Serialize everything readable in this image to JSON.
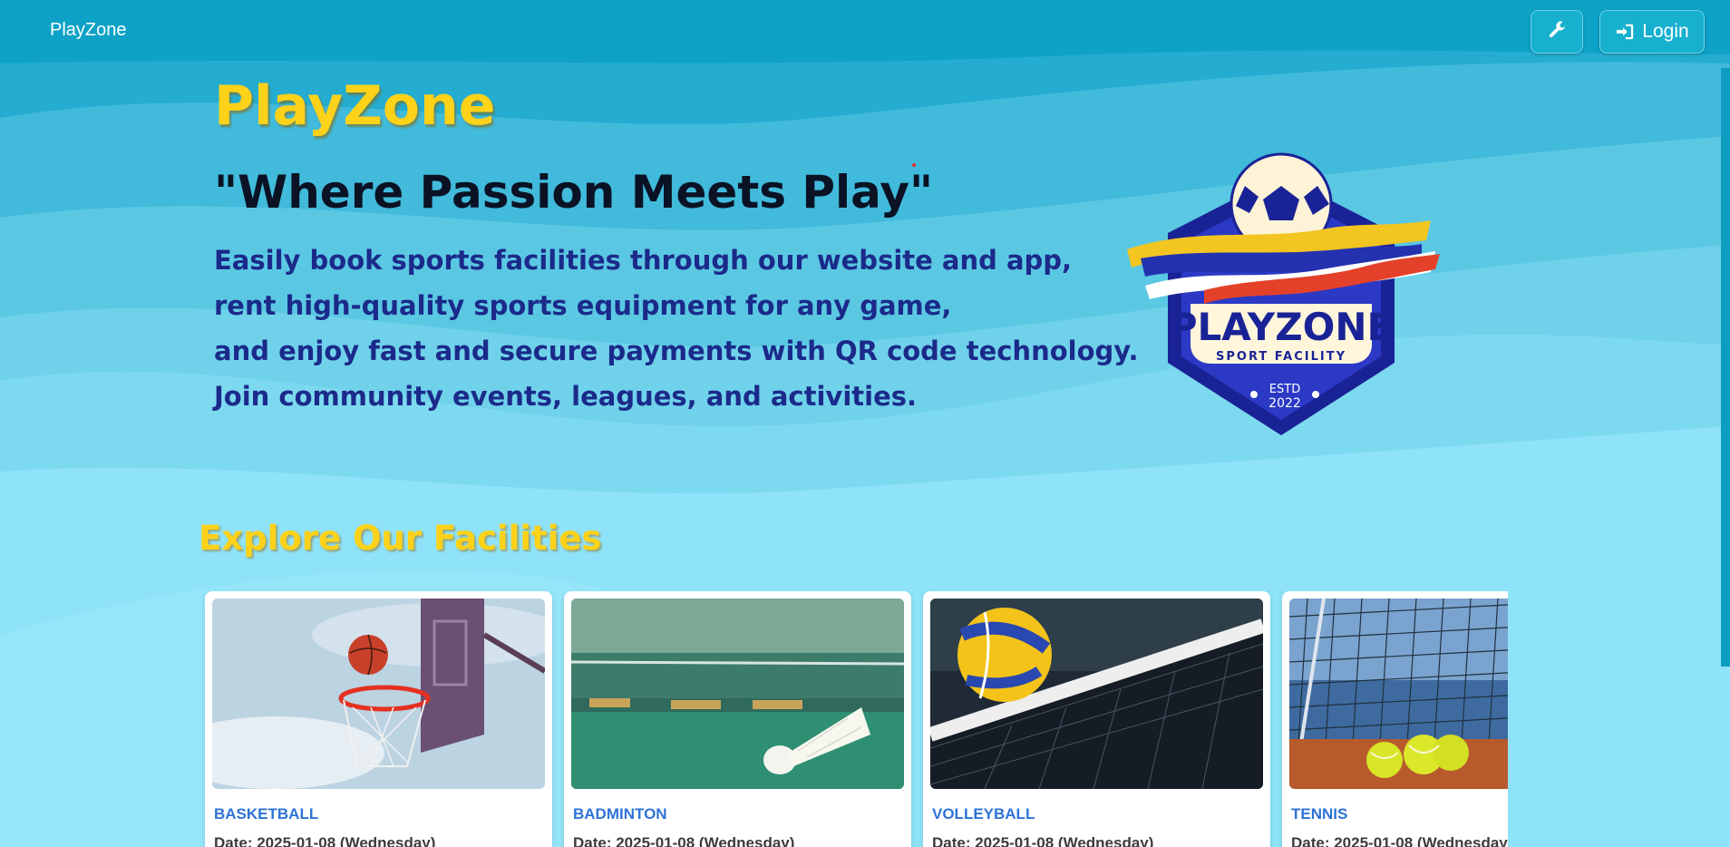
{
  "nav": {
    "brand": "PlayZone",
    "tools_icon": "wrench-icon",
    "login_icon": "sign-in-icon",
    "login_label": "Login"
  },
  "hero": {
    "title": "PlayZone",
    "tagline": "\"Where Passion Meets Play\"",
    "description_lines": [
      "Easily book sports facilities through our website and app,",
      "rent high-quality sports equipment for any game,",
      "and enjoy fast and secure payments with QR code technology.",
      "Join community events, leagues, and activities."
    ]
  },
  "logo": {
    "name": "PLAYZONE",
    "subtitle": "SPORT FACILITY",
    "estd": "ESTD",
    "year": "2022"
  },
  "facilities": {
    "title": "Explore Our Facilities",
    "cards": [
      {
        "name": "BASKETBALL",
        "date": "Date: 2025-01-08 (Wednesday)"
      },
      {
        "name": "BADMINTON",
        "date": "Date: 2025-01-08 (Wednesday)"
      },
      {
        "name": "VOLLEYBALL",
        "date": "Date: 2025-01-08 (Wednesday)"
      },
      {
        "name": "TENNIS",
        "date": "Date: 2025-01-08 (Wednesday)"
      }
    ]
  },
  "colors": {
    "header_bg": "#08a2c4",
    "accent_yellow": "#ffd21a",
    "desc_blue": "#1b2a8a",
    "card_title_blue": "#2e73d6"
  }
}
